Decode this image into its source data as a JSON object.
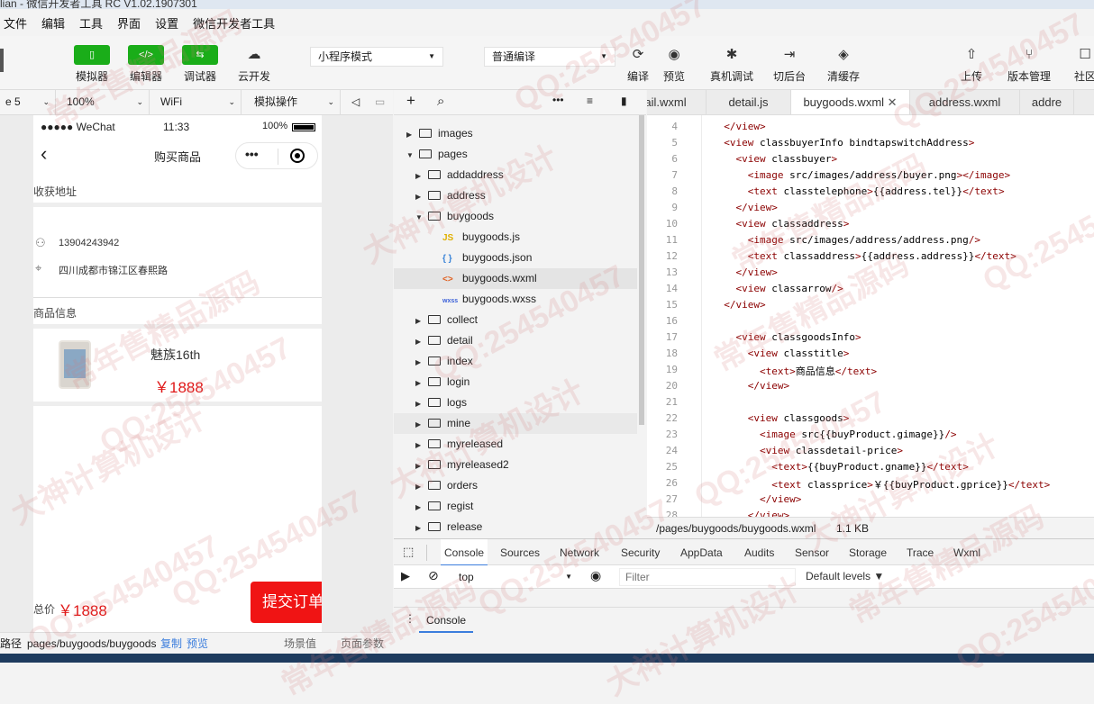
{
  "window": {
    "title": "lian - 微信开发者工具 RC V1.02.1907301"
  },
  "menu": [
    "文件",
    "编辑",
    "工具",
    "界面",
    "设置",
    "微信开发者工具"
  ],
  "toolbar": {
    "simulator": "模拟器",
    "editor": "编辑器",
    "debugger": "调试器",
    "cloud": "云开发",
    "mode": "小程序模式",
    "compile_mode": "普通编译",
    "compile": "编译",
    "preview": "预览",
    "remote_debug": "真机调试",
    "background": "切后台",
    "clear_cache": "清缓存",
    "upload": "上传",
    "version": "版本管理",
    "community": "社区"
  },
  "simbar": {
    "device": "e 5",
    "zoom": "100%",
    "network": "WiFi",
    "operation": "模拟操作"
  },
  "phone": {
    "status_signal": "●●●●● WeChat",
    "status_time": "11:33",
    "status_battery": "100%",
    "nav_title": "购买商品",
    "address_header": "收获地址",
    "phone_number": "13904243942",
    "address": "四川成都市锦江区春熙路",
    "goods_header": "商品信息",
    "goods_name": "魅族16th",
    "goods_price": "￥1888",
    "total_label": "总价",
    "total_price": "￥1888",
    "submit": "提交订单"
  },
  "tree": [
    {
      "label": "images",
      "depth": 0,
      "kind": "folder",
      "open": false
    },
    {
      "label": "pages",
      "depth": 0,
      "kind": "folder",
      "open": true
    },
    {
      "label": "addaddress",
      "depth": 1,
      "kind": "folder",
      "open": false
    },
    {
      "label": "address",
      "depth": 1,
      "kind": "folder",
      "open": false
    },
    {
      "label": "buygoods",
      "depth": 1,
      "kind": "folder",
      "open": true
    },
    {
      "label": "buygoods.js",
      "depth": 2,
      "kind": "js"
    },
    {
      "label": "buygoods.json",
      "depth": 2,
      "kind": "json"
    },
    {
      "label": "buygoods.wxml",
      "depth": 2,
      "kind": "wxml",
      "selected": true
    },
    {
      "label": "buygoods.wxss",
      "depth": 2,
      "kind": "wxss"
    },
    {
      "label": "collect",
      "depth": 1,
      "kind": "folder",
      "open": false
    },
    {
      "label": "detail",
      "depth": 1,
      "kind": "folder",
      "open": false
    },
    {
      "label": "index",
      "depth": 1,
      "kind": "folder",
      "open": false
    },
    {
      "label": "login",
      "depth": 1,
      "kind": "folder",
      "open": false
    },
    {
      "label": "logs",
      "depth": 1,
      "kind": "folder",
      "open": false
    },
    {
      "label": "mine",
      "depth": 1,
      "kind": "folder",
      "open": false,
      "hover": true
    },
    {
      "label": "myreleased",
      "depth": 1,
      "kind": "folder",
      "open": false
    },
    {
      "label": "myreleased2",
      "depth": 1,
      "kind": "folder",
      "open": false
    },
    {
      "label": "orders",
      "depth": 1,
      "kind": "folder",
      "open": false
    },
    {
      "label": "regist",
      "depth": 1,
      "kind": "folder",
      "open": false
    },
    {
      "label": "release",
      "depth": 1,
      "kind": "folder",
      "open": false
    }
  ],
  "tabs": [
    {
      "label": "ail.wxml",
      "active": false
    },
    {
      "label": "detail.js",
      "active": false
    },
    {
      "label": "buygoods.wxml",
      "active": true
    },
    {
      "label": "address.wxml",
      "active": false
    },
    {
      "label": "addre",
      "active": false
    }
  ],
  "code": [
    {
      "n": "4",
      "t": "  </view>"
    },
    {
      "n": "5",
      "t": "  <view class='buyerInfo' bindtap='switchAddress'>"
    },
    {
      "n": "6",
      "t": "    <view class='buyer'>"
    },
    {
      "n": "7",
      "t": "      <image src='/images/address/buyer.png'></image>"
    },
    {
      "n": "8",
      "t": "      <text class='telephone'>{{address.tel}}</text>"
    },
    {
      "n": "9",
      "t": "    </view>"
    },
    {
      "n": "10",
      "t": "    <view class='address'>"
    },
    {
      "n": "11",
      "t": "      <image src='/images/address/address.png'/>"
    },
    {
      "n": "12",
      "t": "      <text class='address'>{{address.address}}</text>"
    },
    {
      "n": "13",
      "t": "    </view>"
    },
    {
      "n": "14",
      "t": "    <view class='arrow'/>"
    },
    {
      "n": "15",
      "t": "  </view>"
    },
    {
      "n": "16",
      "t": ""
    },
    {
      "n": "17",
      "t": "    <view class='goodsInfo'>"
    },
    {
      "n": "18",
      "t": "      <view class='title'>"
    },
    {
      "n": "19",
      "t": "        <text>商品信息</text>"
    },
    {
      "n": "20",
      "t": "      </view>"
    },
    {
      "n": "21",
      "t": ""
    },
    {
      "n": "22",
      "t": "      <view class='goods'>"
    },
    {
      "n": "23",
      "t": "        <image src='{{buyProduct.gimage}}'/>"
    },
    {
      "n": "24",
      "t": "        <view class='detail-price'>"
    },
    {
      "n": "25",
      "t": "          <text>{{buyProduct.gname}}</text>"
    },
    {
      "n": "26",
      "t": "          <text class='price'>￥{{buyProduct.gprice}}</text>"
    },
    {
      "n": "27",
      "t": "        </view>"
    },
    {
      "n": "28",
      "t": "      </view>"
    }
  ],
  "editor_status": {
    "path": "/pages/buygoods/buygoods.wxml",
    "size": "1.1 KB"
  },
  "devtools": {
    "tabs": [
      "Console",
      "Sources",
      "Network",
      "Security",
      "AppData",
      "Audits",
      "Sensor",
      "Storage",
      "Trace",
      "Wxml"
    ],
    "context": "top",
    "filter_placeholder": "Filter",
    "levels": "Default levels ▼",
    "drawer_tab": "Console"
  },
  "statusbar": {
    "path_label": "路径",
    "path": "pages/buygoods/buygoods",
    "copy": "复制",
    "preview": "预览",
    "scene": "场景值",
    "params": "页面参数"
  },
  "watermarks": [
    "常年售精品源码",
    "QQ:254540457",
    "大神计算机设计"
  ]
}
